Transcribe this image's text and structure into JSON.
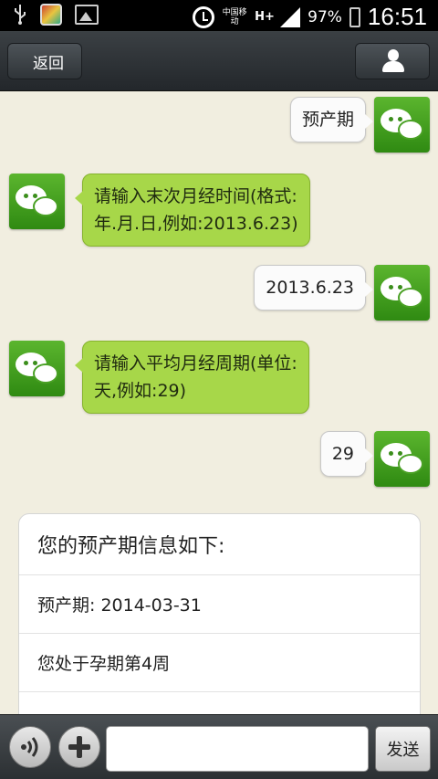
{
  "status_bar": {
    "carrier": "中国移动",
    "network": "H+",
    "battery": "97%",
    "time": "16:51"
  },
  "header": {
    "back_label": "返回"
  },
  "messages": [
    {
      "side": "sent",
      "text": "预产期"
    },
    {
      "side": "received",
      "lines": [
        "请输入末次月经时间(格式:",
        "年.月.日,例如:2013.6.23)"
      ]
    },
    {
      "side": "sent",
      "text": "2013.6.23"
    },
    {
      "side": "received",
      "lines": [
        "请输入平均月经周期(单位:",
        "天,例如:29)"
      ]
    },
    {
      "side": "sent",
      "text": "29"
    }
  ],
  "info_card": {
    "title": "您的预产期信息如下:",
    "rows": [
      "预产期: 2014-03-31",
      "您处于孕期第4周"
    ]
  },
  "input_bar": {
    "send_label": "发送",
    "input_value": ""
  }
}
